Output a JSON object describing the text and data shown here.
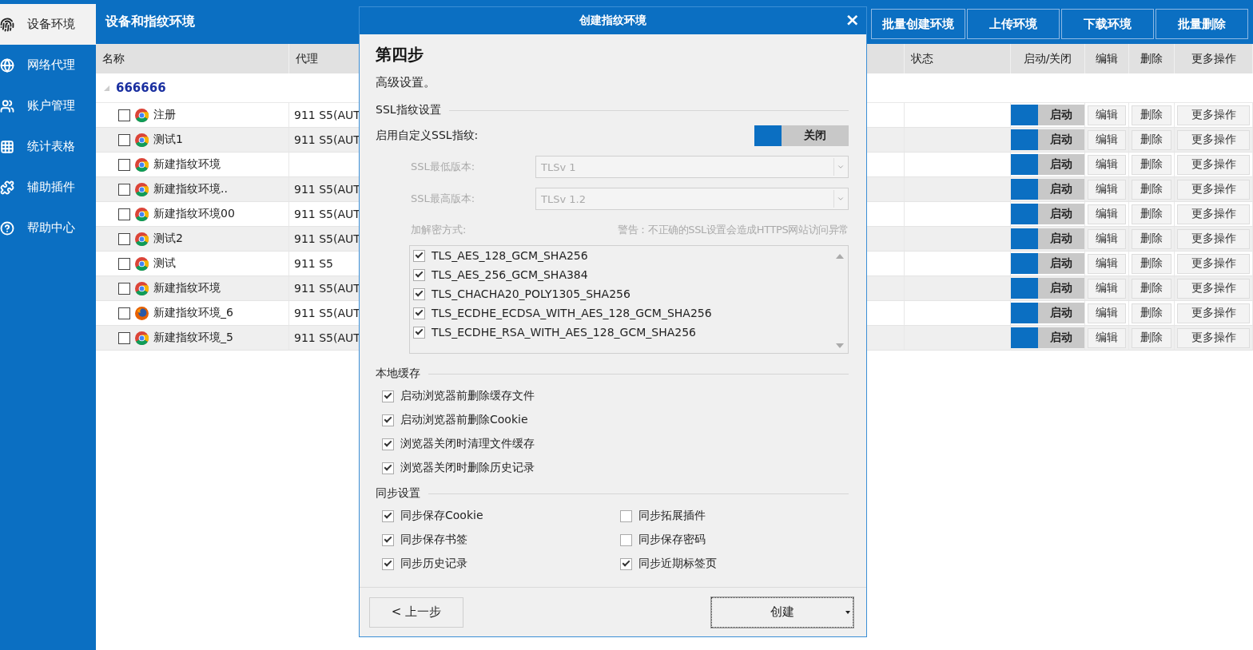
{
  "sidebar": {
    "items": [
      {
        "label": "设备环境",
        "selected": true
      },
      {
        "label": "网络代理",
        "selected": false
      },
      {
        "label": "账户管理",
        "selected": false
      },
      {
        "label": "统计表格",
        "selected": false
      },
      {
        "label": "辅助插件",
        "selected": false
      },
      {
        "label": "帮助中心",
        "selected": false
      }
    ]
  },
  "header": {
    "title": "设备和指纹环境",
    "buttons": [
      "批量创建环境",
      "上传环境",
      "下载环境",
      "批量删除"
    ]
  },
  "table": {
    "columns": [
      "名称",
      "代理",
      "状态",
      "启动/关闭",
      "编辑",
      "删除",
      "更多操作"
    ],
    "group": "666666",
    "rows": [
      {
        "name": "注册",
        "kind": "chrome",
        "proxy": "911 S5(AUT",
        "checked": false,
        "toggle": {
          "label": "启动",
          "on": false
        },
        "actions": [
          "编辑",
          "删除",
          "更多操作"
        ]
      },
      {
        "name": "测试1",
        "kind": "chrome",
        "proxy": "911 S5(AUT",
        "checked": false,
        "toggle": {
          "label": "启动",
          "on": false
        },
        "actions": [
          "编辑",
          "删除",
          "更多操作"
        ]
      },
      {
        "name": "新建指纹环境",
        "kind": "chrome",
        "checked": false,
        "toggle": {
          "label": "启动",
          "on": false
        },
        "actions": [
          "编辑",
          "删除",
          "更多操作"
        ]
      },
      {
        "name": "新建指纹环境..",
        "kind": "chrome",
        "proxy": "911 S5(AUT",
        "checked": false,
        "toggle": {
          "label": "启动",
          "on": false
        },
        "actions": [
          "编辑",
          "删除",
          "更多操作"
        ]
      },
      {
        "name": "新建指纹环境00",
        "kind": "chrome",
        "proxy": "911 S5(AUT",
        "checked": false,
        "toggle": {
          "label": "启动",
          "on": false
        },
        "actions": [
          "编辑",
          "删除",
          "更多操作"
        ]
      },
      {
        "name": "测试2",
        "kind": "chrome",
        "proxy": "911 S5(AUT",
        "checked": false,
        "toggle": {
          "label": "启动",
          "on": false
        },
        "actions": [
          "编辑",
          "删除",
          "更多操作"
        ]
      },
      {
        "name": "测试",
        "kind": "chrome",
        "proxy": "911 S5",
        "checked": false,
        "toggle": {
          "label": "启动",
          "on": false
        },
        "actions": [
          "编辑",
          "删除",
          "更多操作"
        ]
      },
      {
        "name": "新建指纹环境",
        "kind": "chrome",
        "proxy": "911 S5(AUT",
        "checked": false,
        "toggle": {
          "label": "启动",
          "on": false
        },
        "actions": [
          "编辑",
          "删除",
          "更多操作"
        ]
      },
      {
        "name": "新建指纹环境_6",
        "kind": "firefox",
        "proxy": "911 S5(AUT",
        "checked": false,
        "toggle": {
          "label": "启动",
          "on": false
        },
        "actions": [
          "编辑",
          "删除",
          "更多操作"
        ]
      },
      {
        "name": "新建指纹环境_5",
        "kind": "chrome",
        "proxy": "911 S5(AUT",
        "checked": false,
        "toggle": {
          "label": "启动",
          "on": false
        },
        "actions": [
          "编辑",
          "删除",
          "更多操作"
        ]
      }
    ]
  },
  "dialog": {
    "title": "创建指纹环境",
    "close": "×",
    "step": "第四步",
    "subtitle": "高级设置。",
    "ssl": {
      "heading": "SSL指纹设置",
      "custom_label": "启用自定义SSL指纹:",
      "toggle": {
        "label": "关闭",
        "on": false
      },
      "fields": [
        {
          "label": "SSL最低版本:",
          "value": "TLSv 1",
          "disabled": true
        },
        {
          "label": "SSL最高版本:",
          "value": "TLSv 1.2",
          "disabled": true
        }
      ],
      "cipher_label": "加解密方式:",
      "warning": "警告：不正确的SSL设置会造成HTTPS网站访问异常",
      "ciphers": [
        {
          "label": "TLS_AES_128_GCM_SHA256",
          "checked": true
        },
        {
          "label": "TLS_AES_256_GCM_SHA384",
          "checked": true
        },
        {
          "label": "TLS_CHACHA20_POLY1305_SHA256",
          "checked": true
        },
        {
          "label": "TLS_ECDHE_ECDSA_WITH_AES_128_GCM_SHA256",
          "checked": true
        },
        {
          "label": "TLS_ECDHE_RSA_WITH_AES_128_GCM_SHA256",
          "checked": true
        }
      ]
    },
    "cache": {
      "heading": "本地缓存",
      "options": [
        {
          "label": "启动浏览器前删除缓存文件",
          "checked": true
        },
        {
          "label": "启动浏览器前删除Cookie",
          "checked": true
        },
        {
          "label": "浏览器关闭时清理文件缓存",
          "checked": true
        },
        {
          "label": "浏览器关闭时删除历史记录",
          "checked": true
        }
      ]
    },
    "sync": {
      "heading": "同步设置",
      "options": [
        {
          "label": "同步保存Cookie",
          "checked": true
        },
        {
          "label": "同步拓展插件",
          "checked": false
        },
        {
          "label": "同步保存书签",
          "checked": true
        },
        {
          "label": "同步保存密码",
          "checked": false
        },
        {
          "label": "同步历史记录",
          "checked": true
        },
        {
          "label": "同步近期标签页",
          "checked": true
        }
      ]
    },
    "back_button": "< 上一步",
    "create_button": "创建"
  }
}
